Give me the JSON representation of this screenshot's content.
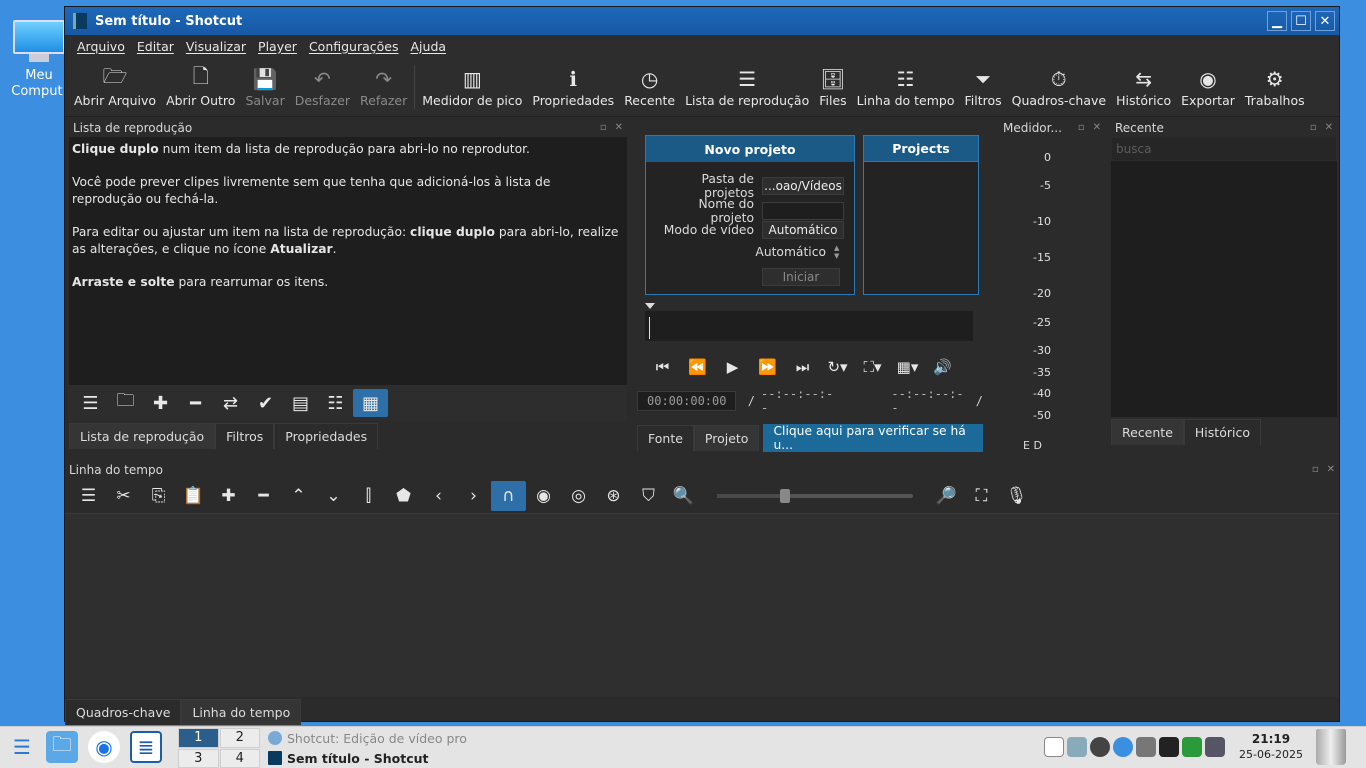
{
  "desktop": {
    "icon_label": "Meu Comput."
  },
  "window": {
    "title": "Sem título - Shotcut",
    "controls": {
      "minimize": "▁",
      "maximize": "☐",
      "close": "✕"
    }
  },
  "menu": [
    "Arquivo",
    "Editar",
    "Visualizar",
    "Player",
    "Configurações",
    "Ajuda"
  ],
  "toolbar": [
    {
      "label": "Abrir Arquivo",
      "icon": "folder-open-icon",
      "glyph": "🗁",
      "enabled": true
    },
    {
      "label": "Abrir Outro",
      "icon": "open-other-icon",
      "glyph": "🗋",
      "enabled": true
    },
    {
      "label": "Salvar",
      "icon": "save-icon",
      "glyph": "💾",
      "enabled": false
    },
    {
      "label": "Desfazer",
      "icon": "undo-icon",
      "glyph": "↶",
      "enabled": false
    },
    {
      "label": "Refazer",
      "icon": "redo-icon",
      "glyph": "↷",
      "enabled": false
    },
    {
      "label": "Medidor de pico",
      "icon": "peak-meter-icon",
      "glyph": "▥",
      "enabled": true
    },
    {
      "label": "Propriedades",
      "icon": "info-icon",
      "glyph": "ℹ",
      "enabled": true
    },
    {
      "label": "Recente",
      "icon": "clock-icon",
      "glyph": "◷",
      "enabled": true
    },
    {
      "label": "Lista de reprodução",
      "icon": "playlist-icon",
      "glyph": "☰",
      "enabled": true
    },
    {
      "label": "Files",
      "icon": "files-icon",
      "glyph": "🗄",
      "enabled": true
    },
    {
      "label": "Linha do tempo",
      "icon": "timeline-icon",
      "glyph": "☷",
      "enabled": true
    },
    {
      "label": "Filtros",
      "icon": "filter-icon",
      "glyph": "⏷",
      "enabled": true
    },
    {
      "label": "Quadros-chave",
      "icon": "stopwatch-icon",
      "glyph": "⏱",
      "enabled": true
    },
    {
      "label": "Histórico",
      "icon": "history-icon",
      "glyph": "⇆",
      "enabled": true
    },
    {
      "label": "Exportar",
      "icon": "export-disc-icon",
      "glyph": "◉",
      "enabled": true
    },
    {
      "label": "Trabalhos",
      "icon": "gear-icon",
      "glyph": "⚙",
      "enabled": true
    }
  ],
  "playlist": {
    "title": "Lista de reprodução",
    "p1_bold": "Clique duplo",
    "p1_rest": " num item da lista de reprodução para abri-lo no reprodutor.",
    "p2": "Você pode prever clipes livremente sem que tenha que adicioná-los à lista de reprodução ou fechá-la.",
    "p3_a": "Para editar ou ajustar um item na lista de reprodução: ",
    "p3_bold1": "clique duplo",
    "p3_b": " para abri-lo, realize as alterações, e clique no ícone ",
    "p3_bold2": "Atualizar",
    "p3_c": ".",
    "p4_bold": "Arraste e solte",
    "p4_rest": " para rearrumar os itens.",
    "tabs": [
      "Lista de reprodução",
      "Filtros",
      "Propriedades"
    ]
  },
  "new_project": {
    "title": "Novo projeto",
    "folder_label": "Pasta de projetos",
    "folder_value": "...oao/Vídeos",
    "name_label": "Nome do projeto",
    "name_value": "",
    "video_mode_label": "Modo de vídeo",
    "video_mode_value": "Automático",
    "auto_label": "Automático",
    "start_button": "Iniciar"
  },
  "projects": {
    "title": "Projects"
  },
  "player": {
    "timecode": "00:00:00:00",
    "separator": "/",
    "duration": "--:--:--:--",
    "in_out": "--:--:--:--",
    "in_out_sep": "/",
    "tabs": [
      "Fonte",
      "Projeto"
    ],
    "update_notice": "Clique aqui para verificar se há u..."
  },
  "meter": {
    "title": "Medidor...",
    "ticks": [
      "0",
      "-5",
      "-10",
      "-15",
      "-20",
      "-25",
      "-30",
      "-35",
      "-40",
      "-50"
    ],
    "channels": "E  D"
  },
  "recent": {
    "title": "Recente",
    "search_placeholder": "busca",
    "tabs": [
      "Recente",
      "Histórico"
    ]
  },
  "timeline": {
    "title": "Linha do tempo",
    "zoom_level": 0.35,
    "tabs": [
      "Quadros-chave",
      "Linha do tempo"
    ]
  },
  "taskbar": {
    "pager": [
      "1",
      "2",
      "3",
      "4"
    ],
    "tasks": [
      {
        "label": "Shotcut: Edição de vídeo pro",
        "active": false
      },
      {
        "label": "Sem título - Shotcut",
        "active": true
      }
    ],
    "clock_time": "21:19",
    "clock_date": "25-06-2025"
  }
}
